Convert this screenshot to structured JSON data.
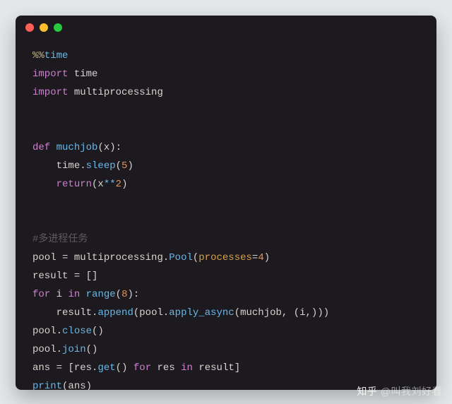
{
  "window": {
    "buttons": [
      "close",
      "minimize",
      "zoom"
    ]
  },
  "code": {
    "lines": [
      {
        "type": "magic",
        "raw": "%%time"
      },
      {
        "type": "import",
        "module": "time"
      },
      {
        "type": "import",
        "module": "multiprocessing"
      },
      {
        "type": "blank"
      },
      {
        "type": "blank"
      },
      {
        "type": "def",
        "name": "muchjob",
        "params": [
          "x"
        ]
      },
      {
        "type": "stmt",
        "indent": 1,
        "code": "time.sleep(5)"
      },
      {
        "type": "return",
        "indent": 1,
        "expr": "x**2"
      },
      {
        "type": "blank"
      },
      {
        "type": "blank"
      },
      {
        "type": "comment",
        "text": "#多进程任务"
      },
      {
        "type": "assign",
        "target": "pool",
        "expr": "multiprocessing.Pool(processes=4)"
      },
      {
        "type": "assign",
        "target": "result",
        "expr": "[]"
      },
      {
        "type": "for",
        "var": "i",
        "iter": "range(8)"
      },
      {
        "type": "stmt",
        "indent": 1,
        "code": "result.append(pool.apply_async(muchjob, (i,)))"
      },
      {
        "type": "stmt",
        "code": "pool.close()"
      },
      {
        "type": "stmt",
        "code": "pool.join()"
      },
      {
        "type": "assign",
        "target": "ans",
        "expr": "[res.get() for res in result]"
      },
      {
        "type": "stmt",
        "code": "print(ans)"
      }
    ]
  },
  "tokens": {
    "l1_magic": "%%",
    "l1_time": "time",
    "l2_import": "import",
    "l2_mod": "time",
    "l3_import": "import",
    "l3_mod": "multiprocessing",
    "l6_def": "def",
    "l6_name": "muchjob",
    "l6_p": "(x):",
    "l7_obj": "time",
    "l7_dot": ".",
    "l7_fn": "sleep",
    "l7_args": "(",
    "l7_num": "5",
    "l7_close": ")",
    "l8_ret": "return",
    "l8_open": "(x",
    "l8_op": "**",
    "l8_num": "2",
    "l8_close": ")",
    "l11_comment": "#多进程任务",
    "l12_lhs": "pool",
    "l12_eq": " = ",
    "l12_mod": "multiprocessing",
    "l12_dot": ".",
    "l12_fn": "Pool",
    "l12_open": "(",
    "l12_kw": "processes",
    "l12_eq2": "=",
    "l12_num": "4",
    "l12_close": ")",
    "l13_lhs": "result",
    "l13_eq": " = ",
    "l13_val": "[]",
    "l14_for": "for",
    "l14_var": " i ",
    "l14_in": "in",
    "l14_sp": " ",
    "l14_fn": "range",
    "l14_open": "(",
    "l14_num": "8",
    "l14_close": "):",
    "l15_obj": "result",
    "l15_dot": ".",
    "l15_fn": "append",
    "l15_open": "(",
    "l15_obj2": "pool",
    "l15_dot2": ".",
    "l15_fn2": "apply_async",
    "l15_args": "(muchjob, (i,)))",
    "l16_obj": "pool",
    "l16_dot": ".",
    "l16_fn": "close",
    "l16_p": "()",
    "l17_obj": "pool",
    "l17_dot": ".",
    "l17_fn": "join",
    "l17_p": "()",
    "l18_lhs": "ans",
    "l18_eq": " = ",
    "l18_open": "[res",
    "l18_dot": ".",
    "l18_fn": "get",
    "l18_p": "() ",
    "l18_for": "for",
    "l18_mid": " res ",
    "l18_in": "in",
    "l18_end": " result]",
    "l19_fn": "print",
    "l19_args": "(ans)"
  },
  "watermark": {
    "site": "知乎",
    "handle": "@叫我刘好看"
  }
}
